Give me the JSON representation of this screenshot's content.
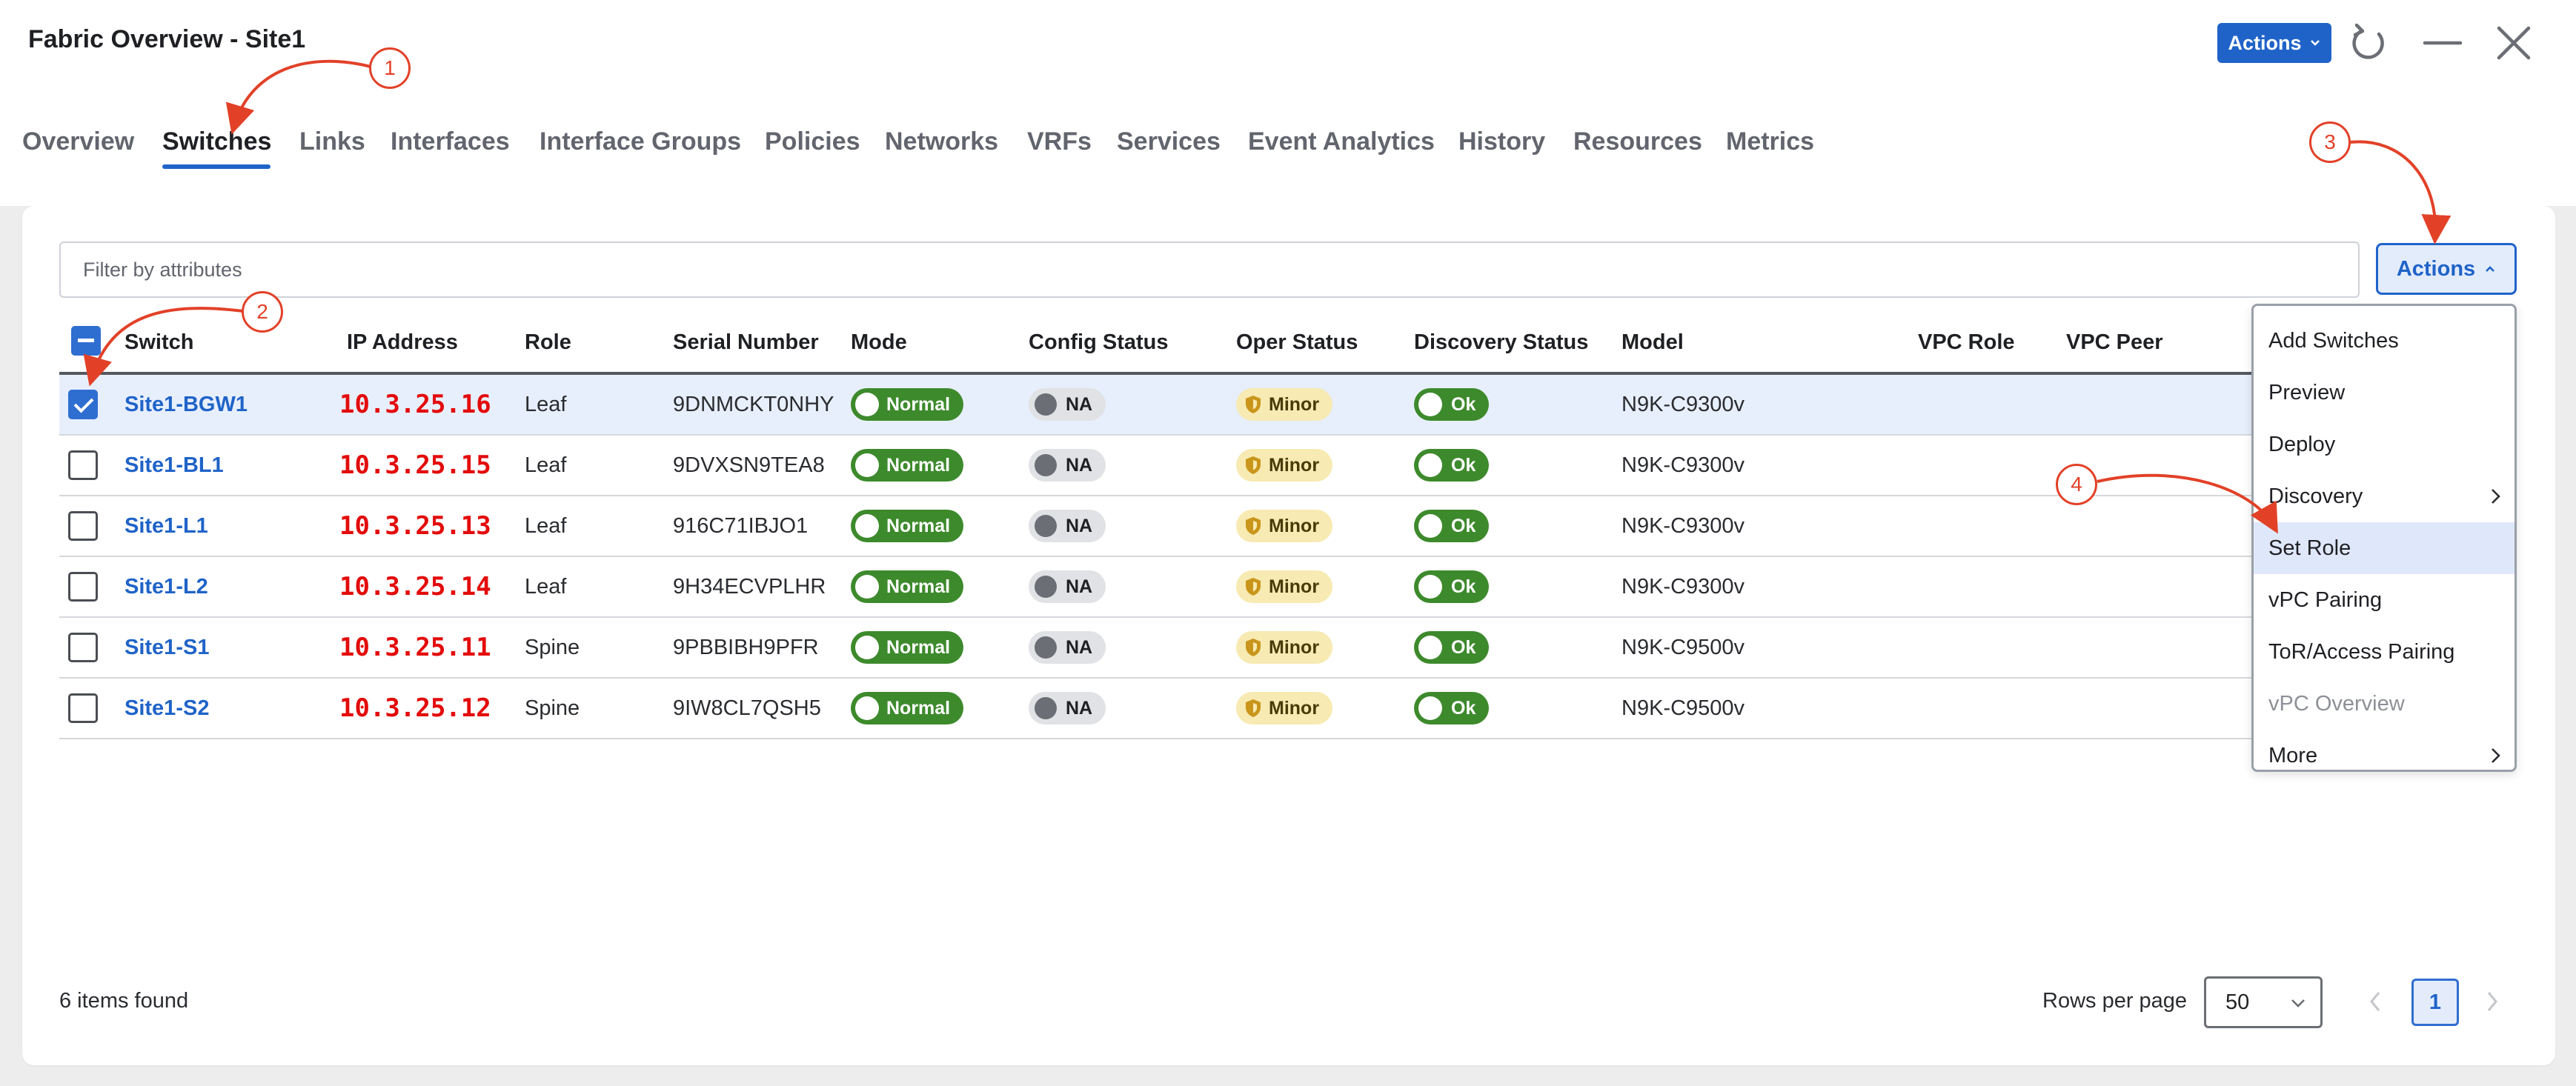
{
  "header": {
    "title": "Fabric Overview - Site1",
    "actions_label": "Actions"
  },
  "tabs": [
    "Overview",
    "Switches",
    "Links",
    "Interfaces",
    "Interface Groups",
    "Policies",
    "Networks",
    "VRFs",
    "Services",
    "Event Analytics",
    "History",
    "Resources",
    "Metrics"
  ],
  "active_tab": "Switches",
  "filter": {
    "placeholder": "Filter by attributes"
  },
  "actions_button": {
    "label": "Actions"
  },
  "table": {
    "columns": [
      "Switch",
      "IP Address",
      "Role",
      "Serial Number",
      "Mode",
      "Config Status",
      "Oper Status",
      "Discovery Status",
      "Model",
      "VPC Role",
      "VPC Peer"
    ],
    "rows": [
      {
        "switch": "Site1-BGW1",
        "ip": "10.3.25.16",
        "role": "Leaf",
        "serial": "9DNMCKT0NHY",
        "mode": "Normal",
        "config": "NA",
        "oper": "Minor",
        "discovery": "Ok",
        "model": "N9K-C9300v",
        "checked": true
      },
      {
        "switch": "Site1-BL1",
        "ip": "10.3.25.15",
        "role": "Leaf",
        "serial": "9DVXSN9TEA8",
        "mode": "Normal",
        "config": "NA",
        "oper": "Minor",
        "discovery": "Ok",
        "model": "N9K-C9300v",
        "checked": false
      },
      {
        "switch": "Site1-L1",
        "ip": "10.3.25.13",
        "role": "Leaf",
        "serial": "916C71IBJO1",
        "mode": "Normal",
        "config": "NA",
        "oper": "Minor",
        "discovery": "Ok",
        "model": "N9K-C9300v",
        "checked": false
      },
      {
        "switch": "Site1-L2",
        "ip": "10.3.25.14",
        "role": "Leaf",
        "serial": "9H34ECVPLHR",
        "mode": "Normal",
        "config": "NA",
        "oper": "Minor",
        "discovery": "Ok",
        "model": "N9K-C9300v",
        "checked": false
      },
      {
        "switch": "Site1-S1",
        "ip": "10.3.25.11",
        "role": "Spine",
        "serial": "9PBBIBH9PFR",
        "mode": "Normal",
        "config": "NA",
        "oper": "Minor",
        "discovery": "Ok",
        "model": "N9K-C9500v",
        "checked": false
      },
      {
        "switch": "Site1-S2",
        "ip": "10.3.25.12",
        "role": "Spine",
        "serial": "9IW8CL7QSH5",
        "mode": "Normal",
        "config": "NA",
        "oper": "Minor",
        "discovery": "Ok",
        "model": "N9K-C9500v",
        "checked": false
      }
    ]
  },
  "menu": {
    "items": [
      {
        "label": "Add Switches",
        "submenu": false,
        "highlighted": false,
        "disabled": false
      },
      {
        "label": "Preview",
        "submenu": false,
        "highlighted": false,
        "disabled": false
      },
      {
        "label": "Deploy",
        "submenu": false,
        "highlighted": false,
        "disabled": false
      },
      {
        "label": "Discovery",
        "submenu": true,
        "highlighted": false,
        "disabled": false
      },
      {
        "label": "Set Role",
        "submenu": false,
        "highlighted": true,
        "disabled": false
      },
      {
        "label": "vPC Pairing",
        "submenu": false,
        "highlighted": false,
        "disabled": false
      },
      {
        "label": "ToR/Access Pairing",
        "submenu": false,
        "highlighted": false,
        "disabled": false
      },
      {
        "label": "vPC Overview",
        "submenu": false,
        "highlighted": false,
        "disabled": true
      },
      {
        "label": "More",
        "submenu": true,
        "highlighted": false,
        "disabled": false
      }
    ]
  },
  "footer": {
    "items_found": "6 items found",
    "rows_per_page_label": "Rows per page",
    "rows_per_page": "50",
    "current_page": "1"
  },
  "annotations": [
    "1",
    "2",
    "3",
    "4"
  ],
  "colors": {
    "accent": "#1f63c8",
    "ok_green": "#3d8a2c",
    "minor_yellow": "#f7eab2",
    "ip_red": "#e30b0b",
    "annotation_red": "#e24128"
  }
}
